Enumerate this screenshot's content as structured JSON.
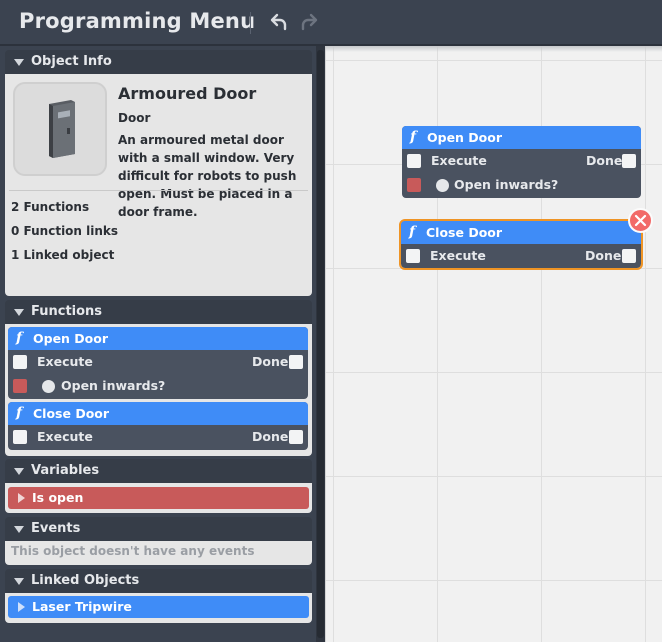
{
  "header": {
    "title": "Programming Menu"
  },
  "object_info": {
    "section_title": "Object Info",
    "name": "Armoured Door",
    "type": "Door",
    "description": "An armoured metal door with a small window. Very difficult for robots to push open. Must be placed in a door frame.",
    "stats": [
      "2 Functions",
      "0 Function links",
      "1 Linked object"
    ]
  },
  "functions": {
    "section_title": "Functions",
    "items": [
      {
        "name": "Open Door",
        "execute": "Execute",
        "done": "Done",
        "param": "Open inwards?"
      },
      {
        "name": "Close Door",
        "execute": "Execute",
        "done": "Done"
      }
    ]
  },
  "variables": {
    "section_title": "Variables",
    "items": [
      "Is open"
    ]
  },
  "events": {
    "section_title": "Events",
    "empty_text": "This object doesn't have any events"
  },
  "linked_objects": {
    "section_title": "Linked Objects",
    "items": [
      "Laser Tripwire"
    ]
  },
  "canvas": {
    "nodes": [
      {
        "name": "Open Door",
        "execute": "Execute",
        "done": "Done",
        "param": "Open inwards?"
      },
      {
        "name": "Close Door",
        "execute": "Execute",
        "done": "Done"
      }
    ]
  },
  "colors": {
    "function_header": "#3f8cf7",
    "variable": "#c85a5a",
    "selection": "#ef9425",
    "delete": "#f26a68"
  },
  "icons": {
    "function": "f",
    "undo": "undo-icon",
    "redo": "redo-icon",
    "collapse": "triangle-down-icon",
    "delete": "close-icon"
  }
}
